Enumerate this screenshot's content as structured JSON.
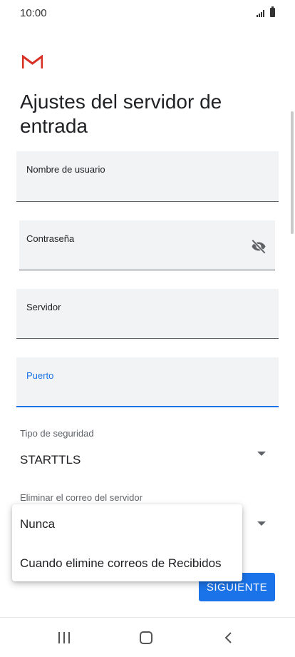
{
  "status_bar": {
    "time": "10:00"
  },
  "header": {
    "title": "Ajustes del servidor de entrada"
  },
  "fields": {
    "username": {
      "label": "Nombre de usuario",
      "value": ""
    },
    "password": {
      "label": "Contraseña",
      "value": ""
    },
    "server": {
      "label": "Servidor",
      "value": ""
    },
    "port": {
      "label": "Puerto",
      "value": ""
    }
  },
  "security": {
    "label": "Tipo de seguridad",
    "value": "STARTTLS"
  },
  "delete_mail": {
    "label": "Eliminar el correo del servidor"
  },
  "menu": {
    "options": [
      "Nunca",
      "Cuando elimine correos de Recibidos"
    ]
  },
  "actions": {
    "next_label": "SIGUIENTE"
  },
  "colors": {
    "accent": "#1a73e8",
    "gmail_red": "#d93025",
    "field_bg": "#f1f3f4"
  },
  "icons": [
    "gmail-logo",
    "signal-icon",
    "battery-icon",
    "visibility-off-icon",
    "chevron-down-icon",
    "recent-apps-icon",
    "home-icon",
    "back-icon"
  ]
}
